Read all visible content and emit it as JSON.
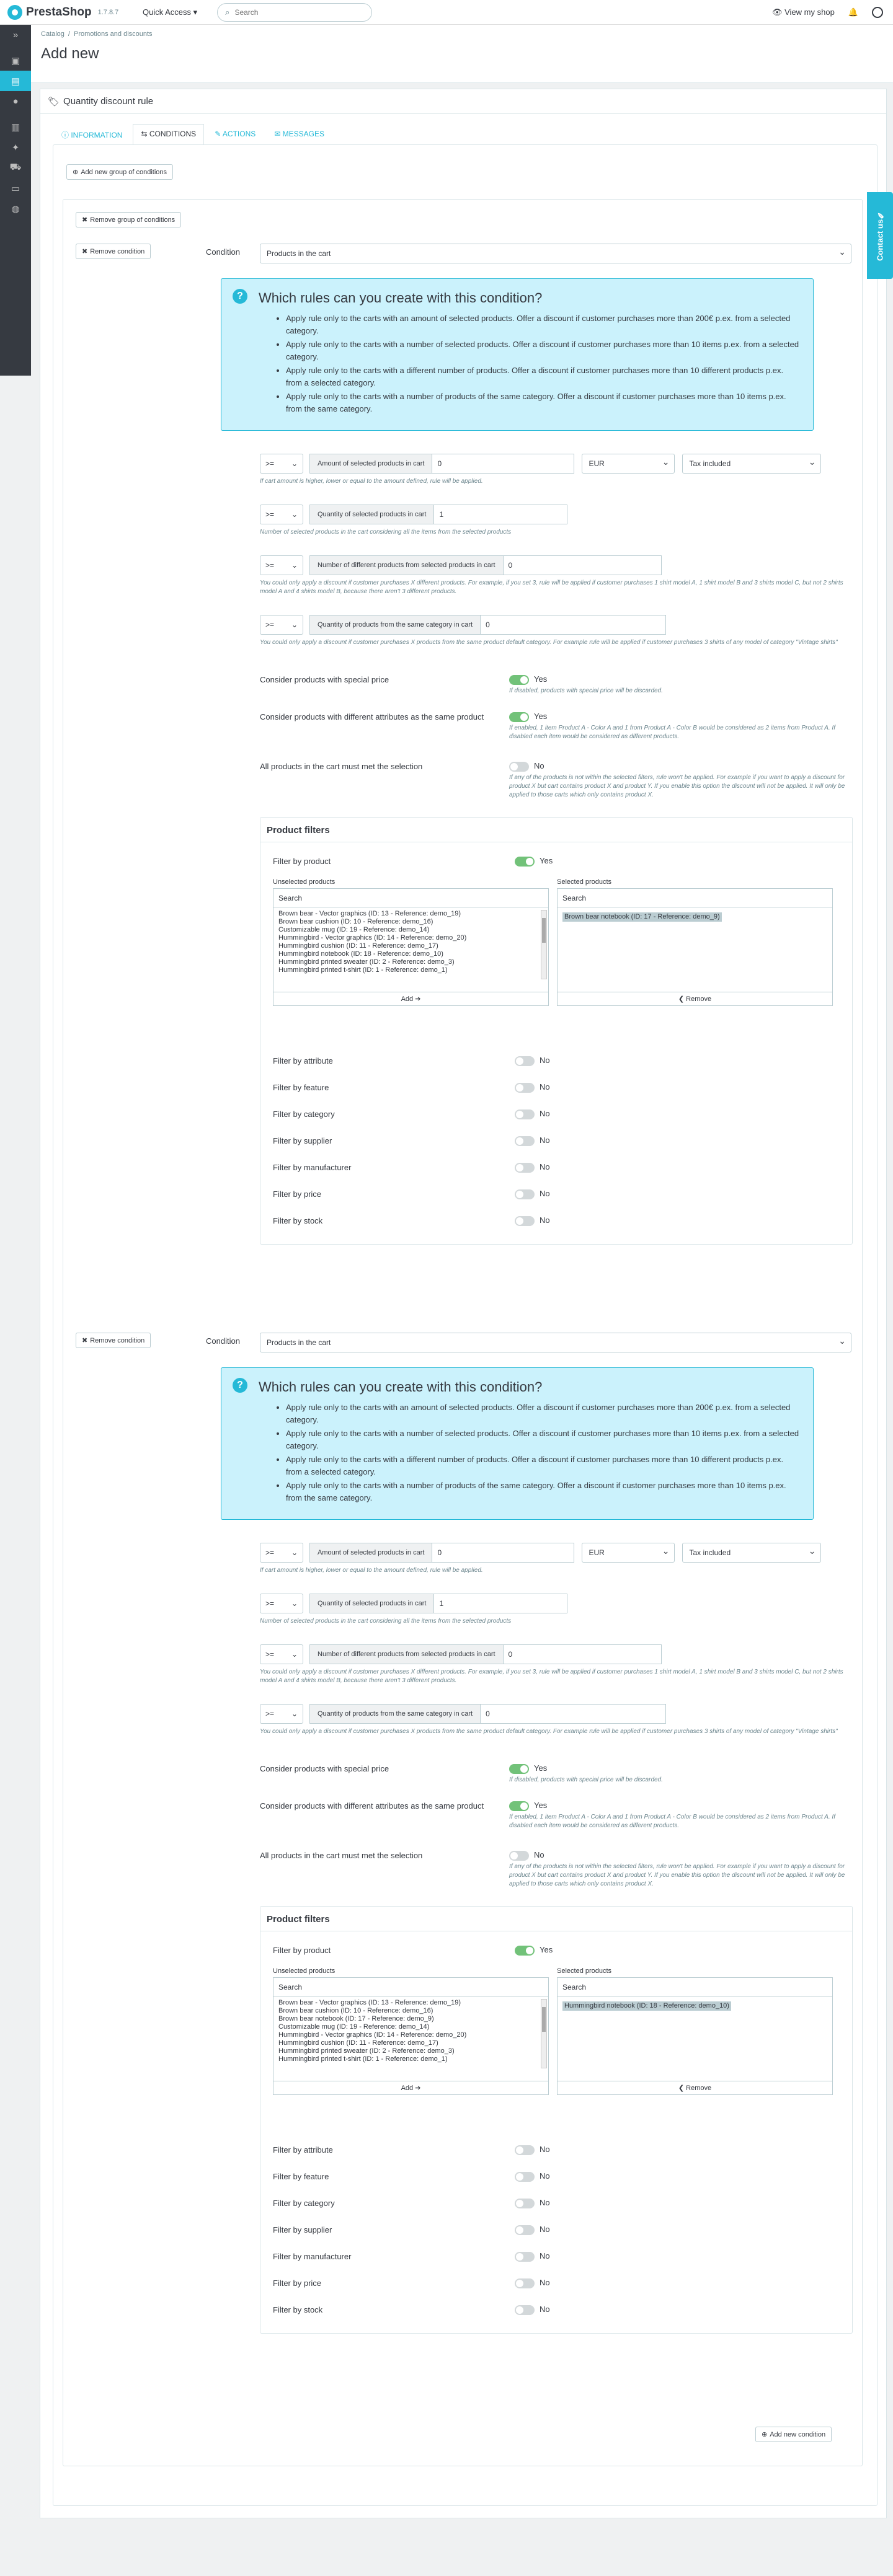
{
  "topbar": {
    "brand": "PrestaShop",
    "version": "1.7.8.7",
    "quick_access": "Quick Access ▾",
    "search_placeholder": "Search",
    "view_shop": "View my shop"
  },
  "breadcrumb": [
    "Catalog",
    "/",
    "Promotions and discounts"
  ],
  "page_title": "Add new",
  "card_title": "Quantity discount rule",
  "tabs": [
    "INFORMATION",
    "CONDITIONS",
    "ACTIONS",
    "MESSAGES"
  ],
  "add_group_label": "Add new group of conditions",
  "remove_group_label": "Remove group of conditions",
  "contact_us": "Contact us",
  "add_condition_label": "Add new condition",
  "conditions": [
    {
      "remove_label": "Remove condition",
      "condition_label": "Condition",
      "condition_value": "Products in the cart",
      "help_title": "Which rules can you create with this condition?",
      "help_items": [
        "Apply rule only to the carts with an amount of selected products. Offer a discount if customer purchases more than 200€ p.ex. from a selected category.",
        "Apply rule only to the carts with a number of selected products. Offer a discount if customer purchases more than 10 items p.ex. from a selected category.",
        "Apply rule only to the carts with a different number of products. Offer a discount if customer purchases more than 10 different products p.ex. from a selected category.",
        "Apply rule only to the carts with a number of products of the same category. Offer a discount if customer purchases more than 10 items p.ex. from the same category."
      ],
      "amount_op": ">=",
      "amount_label": "Amount of selected products in cart",
      "amount_value": "0",
      "currency": "EUR",
      "tax": "Tax included",
      "amount_help": "If cart amount is higher, lower or equal to the amount defined, rule will be applied.",
      "qty_op": ">=",
      "qty_label": "Quantity of selected products in cart",
      "qty_value": "1",
      "qty_help": "Number of selected products in the cart considering all the items from the selected products",
      "diff_op": ">=",
      "diff_label": "Number of different products from selected products in cart",
      "diff_value": "0",
      "diff_help": "You could only apply a discount if customer purchases X different products. For example, if you set 3, rule will be applied if customer purchases 1 shirt model A, 1 shirt model B and 3 shirts model C, but not 2 shirts model A and 4 shirts model B, because there aren't 3 different products.",
      "cat_op": ">=",
      "cat_label": "Quantity of products from the same category in cart",
      "cat_value": "0",
      "cat_help": "You could only apply a discount if customer purchases X products from the same product default category. For example rule will be applied if customer purchases 3 shirts of any model of category \"Vintage shirts\"",
      "special_label": "Consider products with special price",
      "special_state": "Yes",
      "special_help": "If disabled, products with special price will be discarded.",
      "attr_label": "Consider products with different attributes as the same product",
      "attr_state": "Yes",
      "attr_help": "If enabled, 1 item Product A - Color A and 1 from Product A - Color B would be considered as 2 items from Product A. If disabled each item would be considered as different products.",
      "all_label": "All products in the cart must met the selection",
      "all_state": "No",
      "all_help": "If any of the products is not within the selected filters, rule won't be applied. For example if you want to apply a discount for product X but cart contains product X and product Y. If you enable this option the discount will not be applied. It will only be applied to those carts which only contains product X.",
      "filters_title": "Product filters",
      "filter_by_product": "Filter by product",
      "filter_by_product_state": "Yes",
      "unselected_title": "Unselected products",
      "selected_title": "Selected products",
      "search_label": "Search",
      "unselected_items": [
        "Brown bear - Vector graphics (ID: 13 - Reference: demo_19)",
        "Brown bear cushion (ID: 10 - Reference: demo_16)",
        "Customizable mug (ID: 19 - Reference: demo_14)",
        "Hummingbird - Vector graphics (ID: 14 - Reference: demo_20)",
        "Hummingbird cushion (ID: 11 - Reference: demo_17)",
        "Hummingbird notebook (ID: 18 - Reference: demo_10)",
        "Hummingbird printed sweater (ID: 2 - Reference: demo_3)",
        "Hummingbird printed t-shirt (ID: 1 - Reference: demo_1)"
      ],
      "selected_item": "Brown bear notebook (ID: 17 - Reference: demo_9)",
      "add_label": "Add ➔",
      "remove_label2": "❮ Remove",
      "other_filters": [
        "Filter by attribute",
        "Filter by feature",
        "Filter by category",
        "Filter by supplier",
        "Filter by manufacturer",
        "Filter by price",
        "Filter by stock"
      ],
      "no_label": "No"
    },
    {
      "remove_label": "Remove condition",
      "condition_label": "Condition",
      "condition_value": "Products in the cart",
      "help_title": "Which rules can you create with this condition?",
      "help_items": [
        "Apply rule only to the carts with an amount of selected products. Offer a discount if customer purchases more than 200€ p.ex. from a selected category.",
        "Apply rule only to the carts with a number of selected products. Offer a discount if customer purchases more than 10 items p.ex. from a selected category.",
        "Apply rule only to the carts with a different number of products. Offer a discount if customer purchases more than 10 different products p.ex. from a selected category.",
        "Apply rule only to the carts with a number of products of the same category. Offer a discount if customer purchases more than 10 items p.ex. from the same category."
      ],
      "amount_op": ">=",
      "amount_label": "Amount of selected products in cart",
      "amount_value": "0",
      "currency": "EUR",
      "tax": "Tax included",
      "amount_help": "If cart amount is higher, lower or equal to the amount defined, rule will be applied.",
      "qty_op": ">=",
      "qty_label": "Quantity of selected products in cart",
      "qty_value": "1",
      "qty_help": "Number of selected products in the cart considering all the items from the selected products",
      "diff_op": ">=",
      "diff_label": "Number of different products from selected products in cart",
      "diff_value": "0",
      "diff_help": "You could only apply a discount if customer purchases X different products. For example, if you set 3, rule will be applied if customer purchases 1 shirt model A, 1 shirt model B and 3 shirts model C, but not 2 shirts model A and 4 shirts model B, because there aren't 3 different products.",
      "cat_op": ">=",
      "cat_label": "Quantity of products from the same category in cart",
      "cat_value": "0",
      "cat_help": "You could only apply a discount if customer purchases X products from the same product default category. For example rule will be applied if customer purchases 3 shirts of any model of category \"Vintage shirts\"",
      "special_label": "Consider products with special price",
      "special_state": "Yes",
      "special_help": "If disabled, products with special price will be discarded.",
      "attr_label": "Consider products with different attributes as the same product",
      "attr_state": "Yes",
      "attr_help": "If enabled, 1 item Product A - Color A and 1 from Product A - Color B would be considered as 2 items from Product A. If disabled each item would be considered as different products.",
      "all_label": "All products in the cart must met the selection",
      "all_state": "No",
      "all_help": "If any of the products is not within the selected filters, rule won't be applied. For example if you want to apply a discount for product X but cart contains product X and product Y. If you enable this option the discount will not be applied. It will only be applied to those carts which only contains product X.",
      "filters_title": "Product filters",
      "filter_by_product": "Filter by product",
      "filter_by_product_state": "Yes",
      "unselected_title": "Unselected products",
      "selected_title": "Selected products",
      "search_label": "Search",
      "unselected_items": [
        "Brown bear - Vector graphics (ID: 13 - Reference: demo_19)",
        "Brown bear cushion (ID: 10 - Reference: demo_16)",
        "Brown bear notebook (ID: 17 - Reference: demo_9)",
        "Customizable mug (ID: 19 - Reference: demo_14)",
        "Hummingbird - Vector graphics (ID: 14 - Reference: demo_20)",
        "Hummingbird cushion (ID: 11 - Reference: demo_17)",
        "Hummingbird printed sweater (ID: 2 - Reference: demo_3)",
        "Hummingbird printed t-shirt (ID: 1 - Reference: demo_1)"
      ],
      "selected_item": "Hummingbird notebook (ID: 18 - Reference: demo_10)",
      "add_label": "Add ➔",
      "remove_label2": "❮ Remove",
      "other_filters": [
        "Filter by attribute",
        "Filter by feature",
        "Filter by category",
        "Filter by supplier",
        "Filter by manufacturer",
        "Filter by price",
        "Filter by stock"
      ],
      "no_label": "No"
    }
  ]
}
